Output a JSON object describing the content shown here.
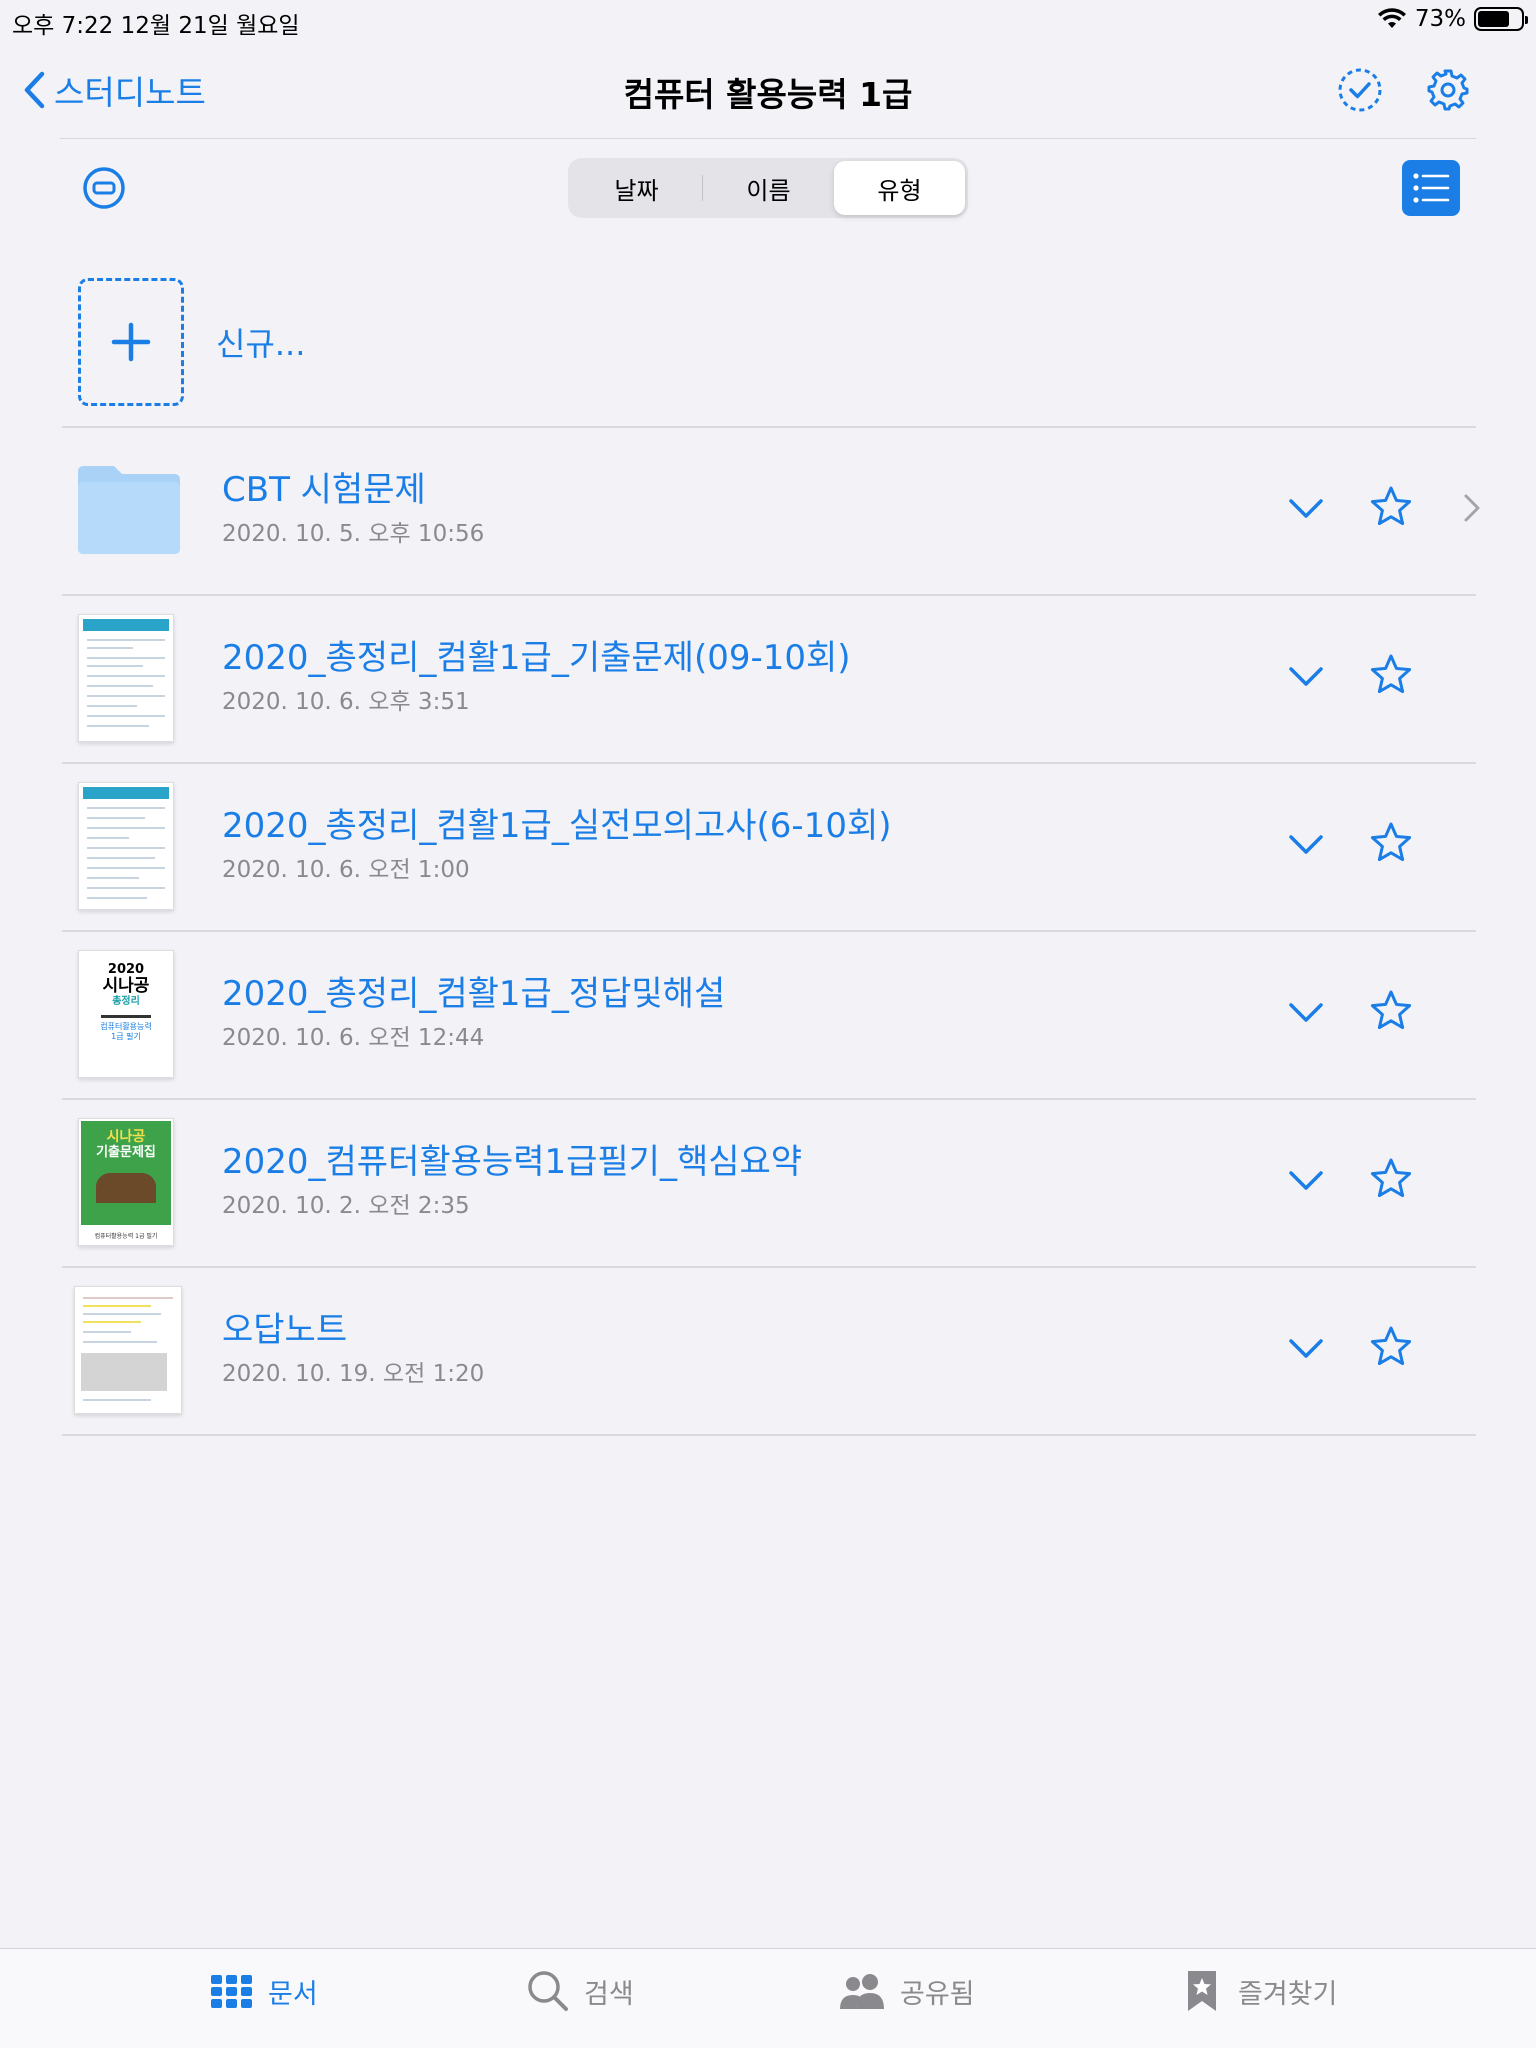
{
  "status_bar": {
    "time_date": "오후 7:22   12월 21일 월요일",
    "battery": "73%",
    "battery_level": 0.73
  },
  "nav": {
    "back_label": "스터디노트",
    "title": "컴퓨터 활용능력 1급"
  },
  "sort": {
    "options": [
      "날짜",
      "이름",
      "유형"
    ],
    "selected": "유형"
  },
  "new_item": {
    "label": "신규..."
  },
  "items": [
    {
      "title": "CBT 시험문제",
      "date": "2020. 10. 5. 오후 10:56",
      "kind": "folder"
    },
    {
      "title": "2020_총정리_컴활1급_기출문제(09-10회)",
      "date": "2020. 10. 6. 오후 3:51",
      "kind": "document"
    },
    {
      "title": "2020_총정리_컴활1급_실전모의고사(6-10회)",
      "date": "2020. 10. 6. 오전 1:00",
      "kind": "document"
    },
    {
      "title": "2020_총정리_컴활1급_정답및해설",
      "date": "2020. 10. 6. 오전 12:44",
      "kind": "book-cover"
    },
    {
      "title": "2020_컴퓨터활용능력1급필기_핵심요약",
      "date": "2020. 10. 2. 오전 2:35",
      "kind": "green-cover"
    },
    {
      "title": "오답노트",
      "date": "2020. 10. 19. 오전 1:20",
      "kind": "note"
    }
  ],
  "thumb_text": {
    "cover_year": "2020",
    "cover_brand": "시나공",
    "cover_sub": "총정리",
    "cover_subject": "컴퓨터활용능력",
    "cover_level": "1급 필기",
    "green_title": "시나공",
    "green_sub": "기출문제집",
    "green_footer": "컴퓨터활용능력 1급 필기"
  },
  "tabs": [
    {
      "label": "문서",
      "icon": "grid-icon",
      "active": true
    },
    {
      "label": "검색",
      "icon": "search-icon",
      "active": false
    },
    {
      "label": "공유됨",
      "icon": "people-icon",
      "active": false
    },
    {
      "label": "즐겨찾기",
      "icon": "bookmark-icon",
      "active": false
    }
  ],
  "colors": {
    "accent": "#1a7ee6",
    "background": "#f2f2f7",
    "secondary_text": "#8a8a8e"
  }
}
